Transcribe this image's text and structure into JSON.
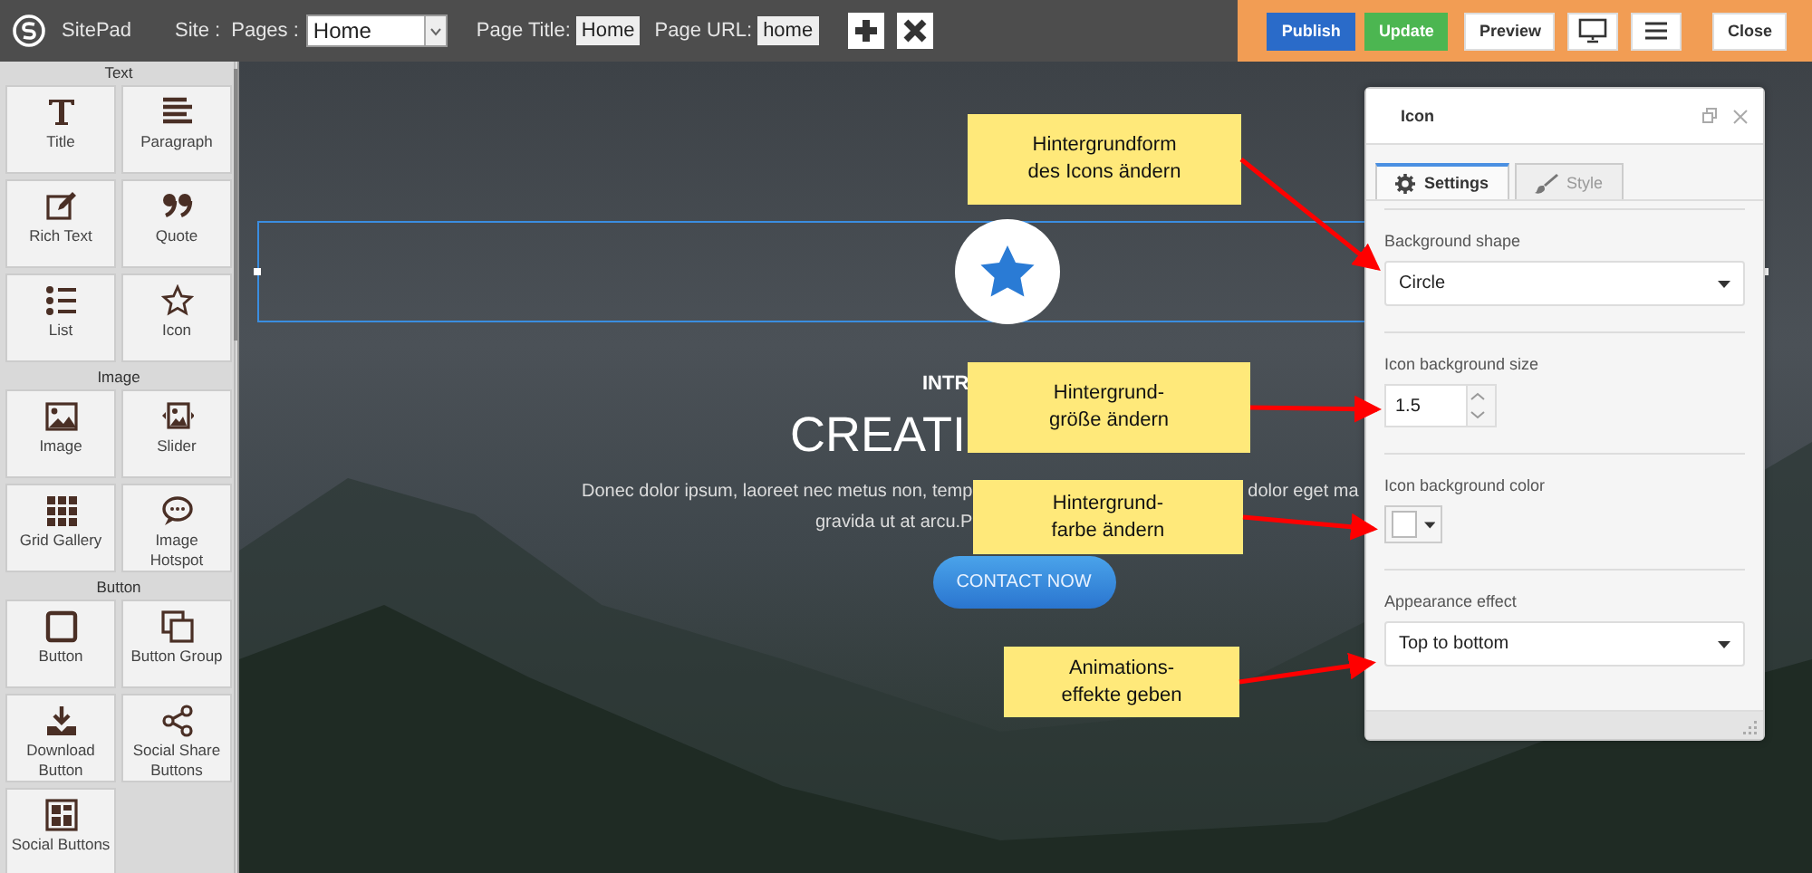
{
  "topbar": {
    "logo_text": "SitePad",
    "site_label": "Site :",
    "pages_label": "Pages :",
    "pages_select": "Home",
    "page_title_label": "Page Title:",
    "page_title_value": "Home",
    "page_url_label": "Page URL:",
    "page_url_value": "home",
    "actions": [
      {
        "kind": "primary",
        "label": "Publish"
      },
      {
        "kind": "success",
        "label": "Update"
      },
      {
        "kind": "plain",
        "label": "Preview"
      },
      {
        "kind": "monitor"
      },
      {
        "kind": "menu"
      },
      {
        "kind": "plain",
        "label": "Close"
      }
    ]
  },
  "sidebar": {
    "groups": [
      {
        "title": "Text",
        "widgets": [
          {
            "kind": "title",
            "label": "Title"
          },
          {
            "kind": "paragraph",
            "label": "Paragraph"
          },
          {
            "kind": "richtext",
            "label": "Rich Text"
          },
          {
            "kind": "quote",
            "label": "Quote"
          },
          {
            "kind": "list",
            "label": "List"
          },
          {
            "kind": "star",
            "label": "Icon"
          }
        ]
      },
      {
        "title": "Image",
        "widgets": [
          {
            "kind": "image",
            "label": "Image"
          },
          {
            "kind": "slider",
            "label": "Slider"
          },
          {
            "kind": "grid",
            "label": "Grid Gallery"
          },
          {
            "kind": "hotspot",
            "label": "Image Hotspot"
          }
        ]
      },
      {
        "title": "Button",
        "widgets": [
          {
            "kind": "button",
            "label": "Button"
          },
          {
            "kind": "buttongroup",
            "label": "Button Group"
          },
          {
            "kind": "download",
            "label": "Download Button"
          },
          {
            "kind": "share",
            "label": "Social Share Buttons"
          },
          {
            "kind": "social",
            "label": "Social Buttons"
          }
        ]
      }
    ]
  },
  "canvas": {
    "kicker": "INTR",
    "title": "CREATI",
    "paragraph_left": "Donec dolor ipsum, laoreet nec metus non, temp",
    "paragraph_right": "dolor eget ma",
    "paragraph_line2": "gravida ut at arcu.P",
    "button": "CONTACT NOW"
  },
  "panel": {
    "title": "Icon",
    "tabs": [
      {
        "label": "Settings",
        "selected": true
      },
      {
        "label": "Style",
        "selected": false
      }
    ],
    "fields": [
      {
        "kind": "select",
        "label": "Background shape",
        "value": "Circle"
      },
      {
        "kind": "number",
        "label": "Icon background size",
        "value": "1.5"
      },
      {
        "kind": "color",
        "label": "Icon background color",
        "color": "#ffffff"
      },
      {
        "kind": "select",
        "label": "Appearance effect",
        "value": "Top to bottom"
      }
    ]
  },
  "callouts": [
    {
      "lines": [
        "Hintergrundform",
        "des Icons ändern"
      ]
    },
    {
      "lines": [
        "Hintergrund-",
        "größe ändern"
      ]
    },
    {
      "lines": [
        "Hintergrund-",
        "farbe ändern"
      ]
    },
    {
      "lines": [
        "Animations-",
        "effekte geben"
      ]
    }
  ]
}
